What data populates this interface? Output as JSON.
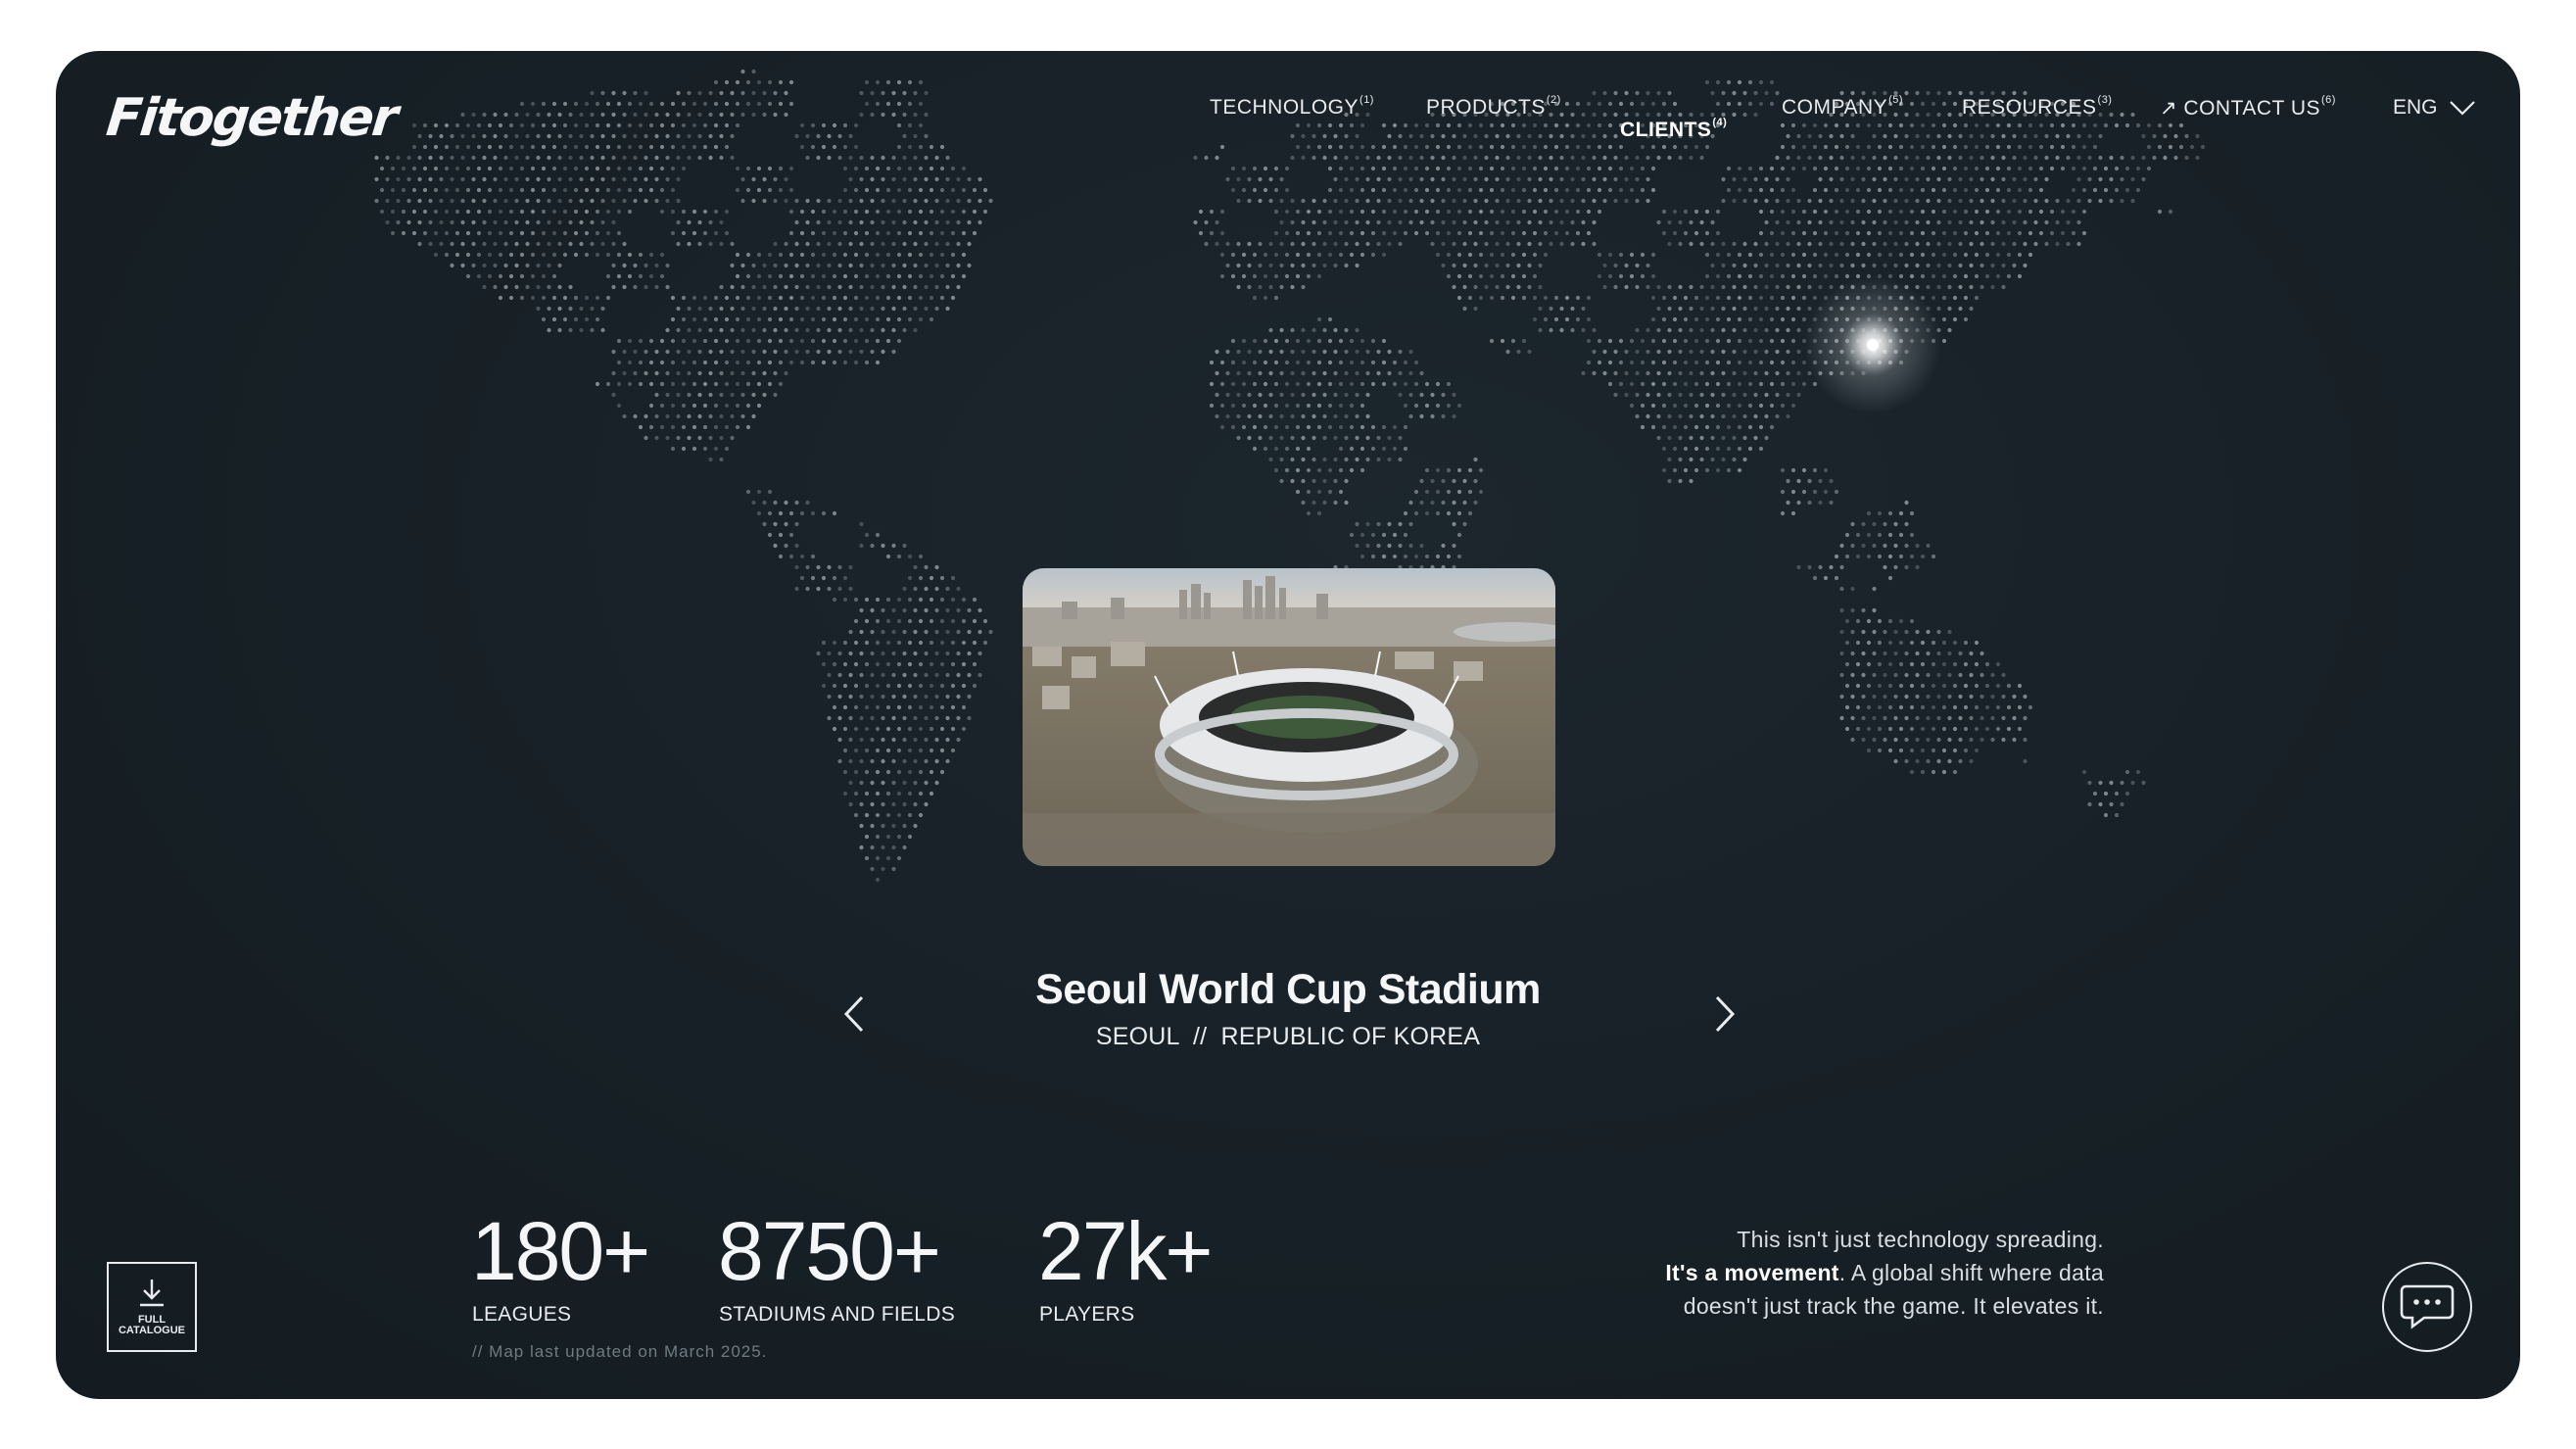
{
  "brand": {
    "logo_text": "Fitogether"
  },
  "nav": {
    "items": [
      {
        "label": "TECHNOLOGY",
        "sup": "(1)"
      },
      {
        "label": "PRODUCTS",
        "sup": "(2)"
      },
      {
        "label": "CLIENTS",
        "sup": "(4)"
      },
      {
        "label": "COMPANY",
        "sup": "(5)"
      },
      {
        "label": "RESOURCES",
        "sup": "(3)"
      },
      {
        "label": "↗ CONTACT US",
        "sup": "(6)"
      }
    ],
    "language": "ENG"
  },
  "venue": {
    "title": "Seoul World Cup Stadium",
    "subtitle": "SEOUL  //  REPUBLIC OF KOREA"
  },
  "stats": [
    {
      "value": "180+",
      "label": "LEAGUES"
    },
    {
      "value": "8750+",
      "label": "STADIUMS AND FIELDS"
    },
    {
      "value": "27k+",
      "label": "PLAYERS"
    }
  ],
  "map_note": "// Map last updated on March 2025.",
  "manifesto": {
    "line1": "This isn't just technology spreading.",
    "bold": "It's a movement",
    "line2_rest": ". A global shift where data",
    "line3": "doesn't just track the game. It elevates it."
  },
  "catalogue": {
    "line1": "FULL",
    "line2": "CATALOGUE"
  },
  "colors": {
    "background": "#172026",
    "text": "#f4f6f7",
    "map_dot": "#9aa3a8",
    "highlight": "#ffffff"
  },
  "icons": [
    "download-icon",
    "chevron-left-icon",
    "chevron-right-icon",
    "chevron-down-icon",
    "chat-icon"
  ]
}
